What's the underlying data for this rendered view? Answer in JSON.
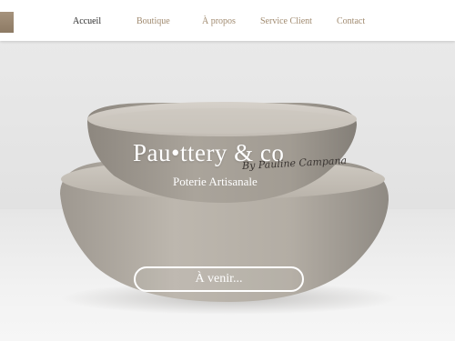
{
  "nav": {
    "items": [
      {
        "label": "Accueil",
        "active": true
      },
      {
        "label": "Boutique",
        "active": false
      },
      {
        "label": "À propos",
        "active": false
      },
      {
        "label": "Service Client",
        "active": false
      },
      {
        "label": "Contact",
        "active": false
      }
    ]
  },
  "hero": {
    "title": "Pau•ttery & co",
    "signature": "By Pauline Campana",
    "subtitle": "Poterie Artisanale",
    "cta_label": "À venir..."
  },
  "colors": {
    "nav_text": "#a08a6f",
    "nav_active": "#2b2b2b",
    "logo_accent": "#9a8670",
    "hero_text": "#ffffff"
  }
}
